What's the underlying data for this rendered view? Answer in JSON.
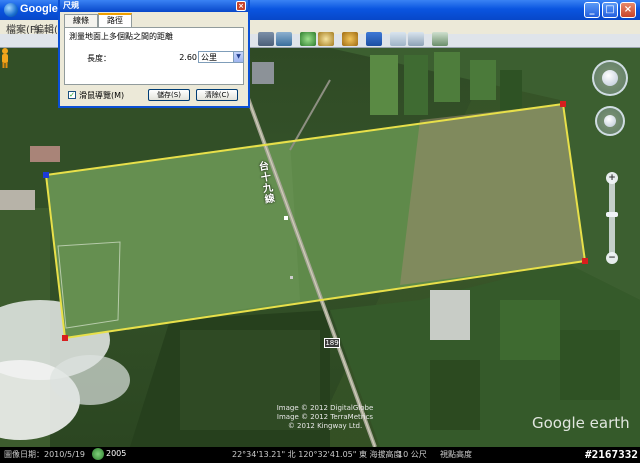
{
  "window": {
    "title": "Google Earth"
  },
  "menu": {
    "items": [
      "檔案(F)",
      "編輯(E)"
    ]
  },
  "dialog": {
    "title": "尺規",
    "tabs": [
      "線條",
      "路徑"
    ],
    "active_tab": "路徑",
    "description": "測量地面上多個點之間的距離",
    "length_label": "長度：",
    "length_value": "2.60",
    "unit": "公里",
    "mouse_nav_label": "滑鼠導覽(M)",
    "save_button": "儲存(S)",
    "clear_button": "清除(C)"
  },
  "map": {
    "road_label": "台十九線",
    "road_number": "189",
    "image_credits": [
      "Image © 2012 DigitalGlobe",
      "Image © 2012 TerraMetrics",
      "© 2012 Kingway Ltd."
    ],
    "watermark": "Google earth"
  },
  "status": {
    "imagery_date": "圖像日期：2010/5/19",
    "year": "2005",
    "coordinates": "22°34'13.21\" 北  120°32'41.05\" 東  海拔高度",
    "elevation": "10 公尺",
    "eye_alt": "視點高度",
    "image_number": "#2167332"
  },
  "colors": {
    "path_line": "#e8e04a",
    "vertex": "#d81e1e",
    "selected_vertex": "#1d3ad8",
    "titlebar": "#0a55e0"
  }
}
